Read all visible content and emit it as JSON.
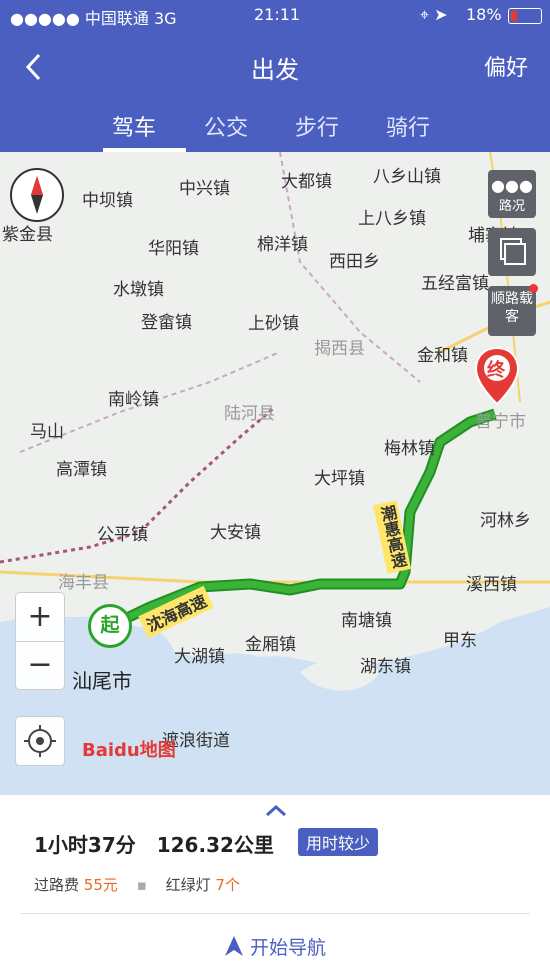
{
  "status": {
    "carrier": "●●●●● 中国联通  3G",
    "time": "21:11",
    "battery": "18%"
  },
  "nav": {
    "back_icon": "chevron-left-icon",
    "title": "出发",
    "preference": "偏好",
    "tabs": [
      {
        "label": "驾车"
      },
      {
        "label": "公交"
      },
      {
        "label": "步行"
      },
      {
        "label": "骑行"
      }
    ]
  },
  "map": {
    "places": [
      "紫金县",
      "中坝镇",
      "中兴镇",
      "大都镇",
      "八乡山镇",
      "华阳镇",
      "棉洋镇",
      "上八乡镇",
      "埔寨镇",
      "西田乡",
      "五经富镇",
      "水墩镇",
      "登畲镇",
      "上砂镇",
      "揭西县",
      "金和镇",
      "南岭镇",
      "陆河县",
      "马山",
      "梅林镇",
      "普宁市",
      "高潭镇",
      "大坪镇",
      "河林乡",
      "公平镇",
      "大安镇",
      "海丰县",
      "溪西镇",
      "南塘镇",
      "甲东",
      "金厢镇",
      "大湖镇",
      "湖东镇",
      "汕尾市",
      "遮浪街道"
    ],
    "highways": [
      "沈海高速",
      "潮惠高速"
    ],
    "start_marker": "起",
    "end_marker": "终",
    "traffic_label": "路况",
    "carpool_label": "顺路载客",
    "zoom_in": "+",
    "zoom_out": "−",
    "logo": "Baidu地图"
  },
  "route": {
    "duration": "1小时37分",
    "distance": "126.32公里",
    "tag": "用时较少",
    "toll_label": "过路费",
    "toll_value": "55元",
    "lights_label": "红绿灯",
    "lights_value": "7个",
    "navigate_label": "开始导航"
  },
  "colors": {
    "primary": "#4a5fc0",
    "route": "#3bb33b",
    "end": "#e53935",
    "highlight": "#e76b23"
  }
}
